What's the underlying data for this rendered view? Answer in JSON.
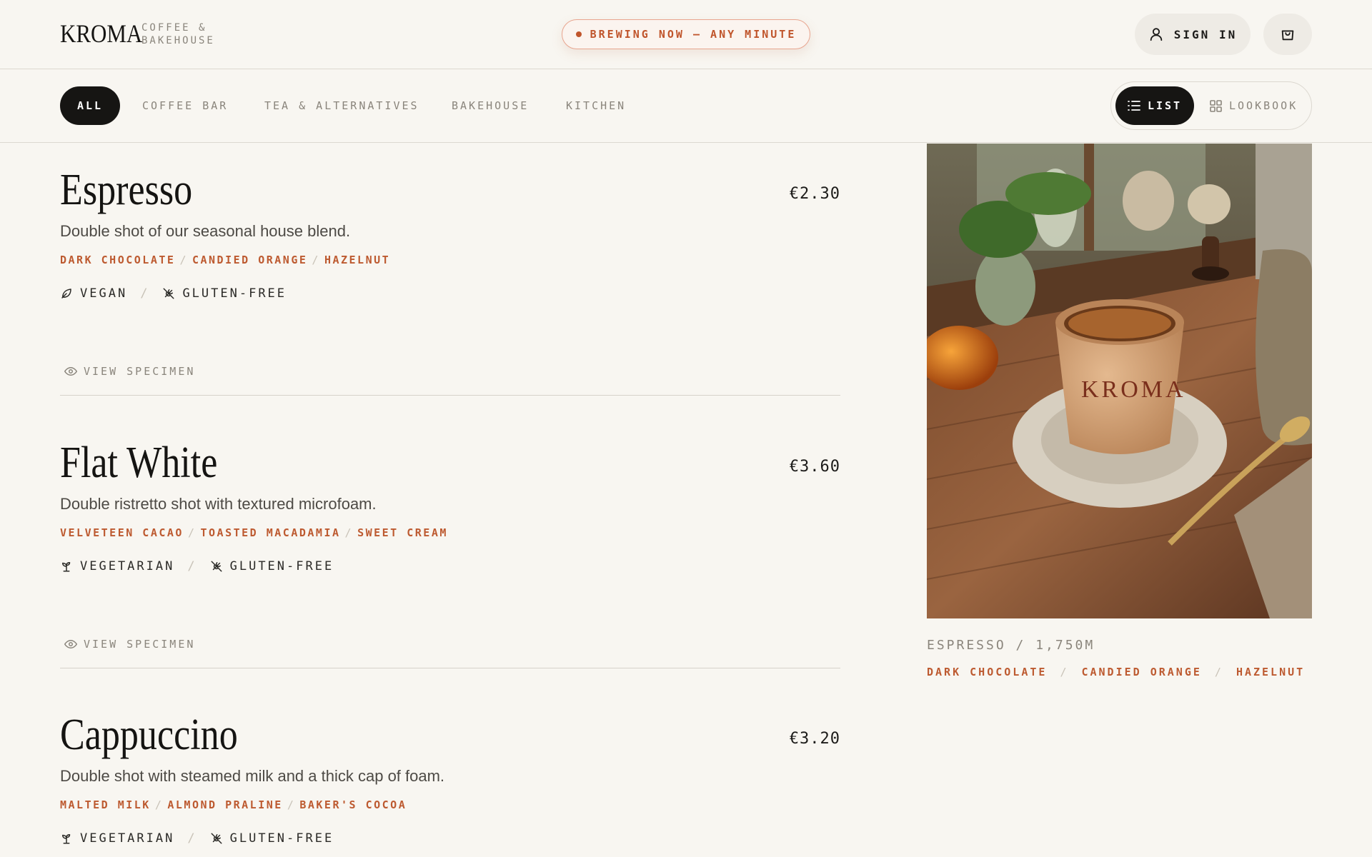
{
  "brand": {
    "logo": "KROMA",
    "subtitle_line1": "COFFEE &",
    "subtitle_line2": "BAKEHOUSE"
  },
  "status": {
    "label": "BREWING NOW — ANY MINUTE"
  },
  "header_actions": {
    "sign_in": "SIGN IN"
  },
  "categories": [
    "ALL",
    "COFFEE BAR",
    "TEA & ALTERNATIVES",
    "BAKEHOUSE",
    "KITCHEN"
  ],
  "view_toggle": {
    "list": "LIST",
    "lookbook": "LOOKBOOK",
    "selected": "LIST"
  },
  "items": [
    {
      "name": "Espresso",
      "price": "€2.30",
      "description": "Double shot of our seasonal house blend.",
      "notes": [
        "DARK CHOCOLATE",
        "CANDIED ORANGE",
        "HAZELNUT"
      ],
      "diet": [
        {
          "label": "VEGAN",
          "icon": "leaf-icon"
        },
        {
          "label": "GLUTEN-FREE",
          "icon": "wheat-off-icon"
        }
      ],
      "specimen": "VIEW SPECIMEN"
    },
    {
      "name": "Flat White",
      "price": "€3.60",
      "description": "Double ristretto shot with textured microfoam.",
      "notes": [
        "VELVETEEN CACAO",
        "TOASTED MACADAMIA",
        "SWEET CREAM"
      ],
      "diet": [
        {
          "label": "VEGETARIAN",
          "icon": "sprout-icon"
        },
        {
          "label": "GLUTEN-FREE",
          "icon": "wheat-off-icon"
        }
      ],
      "specimen": "VIEW SPECIMEN"
    },
    {
      "name": "Cappuccino",
      "price": "€3.20",
      "description": "Double shot with steamed milk and a thick cap of foam.",
      "notes": [
        "MALTED MILK",
        "ALMOND PRALINE",
        "BAKER'S COCOA"
      ],
      "diet": [
        {
          "label": "VEGETARIAN",
          "icon": "sprout-icon"
        },
        {
          "label": "GLUTEN-FREE",
          "icon": "wheat-off-icon"
        }
      ]
    }
  ],
  "feature": {
    "cup_logo": "KROMA",
    "caption": "ESPRESSO / 1,750M",
    "notes": [
      "DARK CHOCOLATE",
      "CANDIED ORANGE",
      "HAZELNUT"
    ]
  },
  "colors": {
    "background": "#f8f6f1",
    "accent": "#bd5a30",
    "ink": "#161513",
    "muted": "#8a857c"
  }
}
